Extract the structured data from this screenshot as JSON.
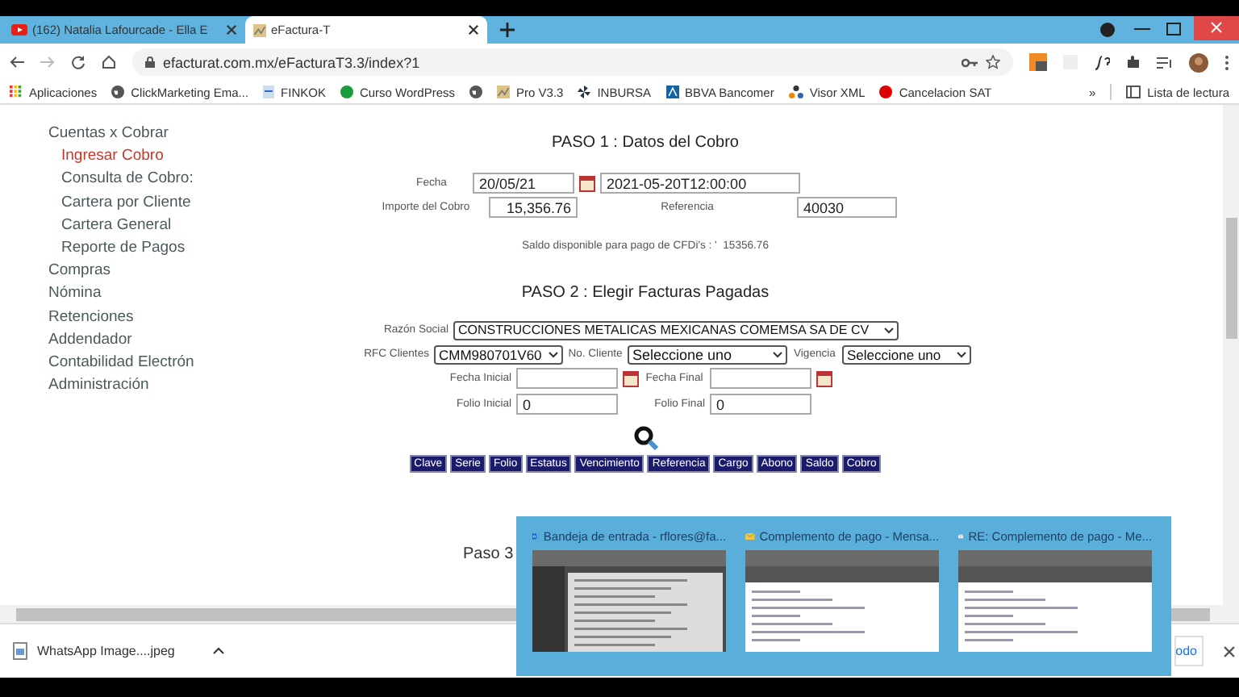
{
  "browser": {
    "tabs": [
      {
        "title": "(162) Natalia Lafourcade - Ella E",
        "selected": false
      },
      {
        "title": "eFactura-T",
        "selected": true
      }
    ],
    "url": "efacturat.com.mx/eFacturaT3.3/index?1",
    "bookmarks": [
      "Aplicaciones",
      "ClickMarketing Ema...",
      "FINKOK",
      "Curso WordPress",
      "Pro V3.3",
      "INBURSA",
      "BBVA Bancomer",
      "Visor XML",
      "Cancelacion SAT"
    ],
    "overflow": "»",
    "reading_list": "Lista de lectura"
  },
  "sidebar": {
    "items": [
      {
        "label": "Cuentas x Cobrar",
        "selected": false,
        "children": [
          {
            "label": "Ingresar Cobro",
            "selected": true
          },
          {
            "label": "Consulta de Cobro:",
            "selected": false
          },
          {
            "label": "Cartera por Cliente",
            "selected": false
          },
          {
            "label": "Cartera General",
            "selected": false
          },
          {
            "label": "Reporte de Pagos",
            "selected": false
          }
        ]
      },
      {
        "label": "Compras",
        "selected": false
      },
      {
        "label": "Nómina",
        "selected": false
      },
      {
        "label": "Retenciones",
        "selected": false
      },
      {
        "label": "Addendador",
        "selected": false
      },
      {
        "label": "Contabilidad Electrón",
        "selected": false
      },
      {
        "label": "Administración",
        "selected": false
      }
    ]
  },
  "step1": {
    "title": "PASO 1 : Datos del Cobro",
    "fecha_label": "Fecha",
    "fecha": "20/05/21",
    "timestamp": "2021-05-20T12:00:00",
    "importe_label": "Importe del Cobro",
    "importe": "15,356.76",
    "referencia_label": "Referencia",
    "referencia": "40030",
    "saldo_label": "Saldo disponible para pago de CFDi's : '",
    "saldo": "15356.76"
  },
  "step2": {
    "title": "PASO 2 : Elegir Facturas Pagadas",
    "razon_label": "Razón Social",
    "razon": "CONSTRUCCIONES METALICAS MEXICANAS COMEMSA SA DE CV",
    "rfc_label": "RFC Clientes",
    "rfc": "CMM980701V60",
    "cliente_label": "No. Cliente",
    "cliente": "Seleccione uno",
    "vigencia_label": "Vigencia",
    "vigencia": "Seleccione uno",
    "fecha_inicial_label": "Fecha Inicial",
    "fecha_final_label": "Fecha Final",
    "folio_inicial_label": "Folio Inicial",
    "folio_inicial": "0",
    "folio_final_label": "Folio Final",
    "folio_final": "0",
    "columns": [
      "Clave",
      "Serie",
      "Folio",
      "Estatus",
      "Vencimiento",
      "Referencia",
      "Cargo",
      "Abono",
      "Saldo",
      "Cobro"
    ]
  },
  "step3": {
    "title": "Paso 3"
  },
  "downloads": {
    "file": "WhatsApp Image....jpeg",
    "show_all": "odo"
  },
  "taskbar_preview": {
    "windows": [
      "Bandeja de entrada - rflores@fa...",
      "Complemento de pago - Mensa...",
      "RE: Complemento de pago - Me..."
    ]
  }
}
